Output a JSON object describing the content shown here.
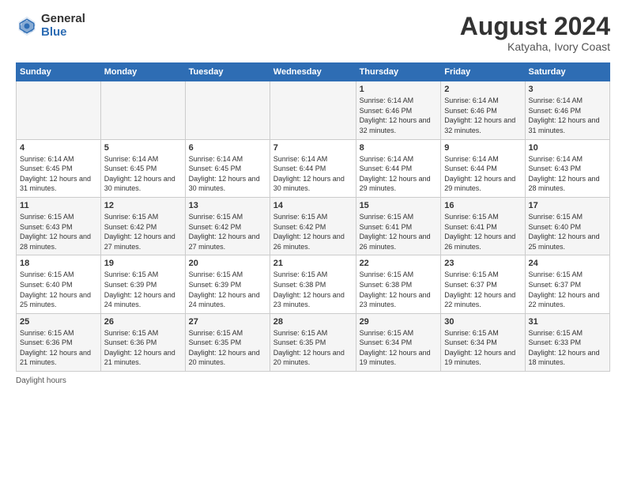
{
  "header": {
    "logo_general": "General",
    "logo_blue": "Blue",
    "month_title": "August 2024",
    "subtitle": "Katyaha, Ivory Coast"
  },
  "footer": {
    "note": "Daylight hours"
  },
  "weekdays": [
    "Sunday",
    "Monday",
    "Tuesday",
    "Wednesday",
    "Thursday",
    "Friday",
    "Saturday"
  ],
  "weeks": [
    [
      {
        "day": "",
        "info": ""
      },
      {
        "day": "",
        "info": ""
      },
      {
        "day": "",
        "info": ""
      },
      {
        "day": "",
        "info": ""
      },
      {
        "day": "1",
        "info": "Sunrise: 6:14 AM\nSunset: 6:46 PM\nDaylight: 12 hours\nand 32 minutes."
      },
      {
        "day": "2",
        "info": "Sunrise: 6:14 AM\nSunset: 6:46 PM\nDaylight: 12 hours\nand 32 minutes."
      },
      {
        "day": "3",
        "info": "Sunrise: 6:14 AM\nSunset: 6:46 PM\nDaylight: 12 hours\nand 31 minutes."
      }
    ],
    [
      {
        "day": "4",
        "info": "Sunrise: 6:14 AM\nSunset: 6:45 PM\nDaylight: 12 hours\nand 31 minutes."
      },
      {
        "day": "5",
        "info": "Sunrise: 6:14 AM\nSunset: 6:45 PM\nDaylight: 12 hours\nand 30 minutes."
      },
      {
        "day": "6",
        "info": "Sunrise: 6:14 AM\nSunset: 6:45 PM\nDaylight: 12 hours\nand 30 minutes."
      },
      {
        "day": "7",
        "info": "Sunrise: 6:14 AM\nSunset: 6:44 PM\nDaylight: 12 hours\nand 30 minutes."
      },
      {
        "day": "8",
        "info": "Sunrise: 6:14 AM\nSunset: 6:44 PM\nDaylight: 12 hours\nand 29 minutes."
      },
      {
        "day": "9",
        "info": "Sunrise: 6:14 AM\nSunset: 6:44 PM\nDaylight: 12 hours\nand 29 minutes."
      },
      {
        "day": "10",
        "info": "Sunrise: 6:14 AM\nSunset: 6:43 PM\nDaylight: 12 hours\nand 28 minutes."
      }
    ],
    [
      {
        "day": "11",
        "info": "Sunrise: 6:15 AM\nSunset: 6:43 PM\nDaylight: 12 hours\nand 28 minutes."
      },
      {
        "day": "12",
        "info": "Sunrise: 6:15 AM\nSunset: 6:42 PM\nDaylight: 12 hours\nand 27 minutes."
      },
      {
        "day": "13",
        "info": "Sunrise: 6:15 AM\nSunset: 6:42 PM\nDaylight: 12 hours\nand 27 minutes."
      },
      {
        "day": "14",
        "info": "Sunrise: 6:15 AM\nSunset: 6:42 PM\nDaylight: 12 hours\nand 26 minutes."
      },
      {
        "day": "15",
        "info": "Sunrise: 6:15 AM\nSunset: 6:41 PM\nDaylight: 12 hours\nand 26 minutes."
      },
      {
        "day": "16",
        "info": "Sunrise: 6:15 AM\nSunset: 6:41 PM\nDaylight: 12 hours\nand 26 minutes."
      },
      {
        "day": "17",
        "info": "Sunrise: 6:15 AM\nSunset: 6:40 PM\nDaylight: 12 hours\nand 25 minutes."
      }
    ],
    [
      {
        "day": "18",
        "info": "Sunrise: 6:15 AM\nSunset: 6:40 PM\nDaylight: 12 hours\nand 25 minutes."
      },
      {
        "day": "19",
        "info": "Sunrise: 6:15 AM\nSunset: 6:39 PM\nDaylight: 12 hours\nand 24 minutes."
      },
      {
        "day": "20",
        "info": "Sunrise: 6:15 AM\nSunset: 6:39 PM\nDaylight: 12 hours\nand 24 minutes."
      },
      {
        "day": "21",
        "info": "Sunrise: 6:15 AM\nSunset: 6:38 PM\nDaylight: 12 hours\nand 23 minutes."
      },
      {
        "day": "22",
        "info": "Sunrise: 6:15 AM\nSunset: 6:38 PM\nDaylight: 12 hours\nand 23 minutes."
      },
      {
        "day": "23",
        "info": "Sunrise: 6:15 AM\nSunset: 6:37 PM\nDaylight: 12 hours\nand 22 minutes."
      },
      {
        "day": "24",
        "info": "Sunrise: 6:15 AM\nSunset: 6:37 PM\nDaylight: 12 hours\nand 22 minutes."
      }
    ],
    [
      {
        "day": "25",
        "info": "Sunrise: 6:15 AM\nSunset: 6:36 PM\nDaylight: 12 hours\nand 21 minutes."
      },
      {
        "day": "26",
        "info": "Sunrise: 6:15 AM\nSunset: 6:36 PM\nDaylight: 12 hours\nand 21 minutes."
      },
      {
        "day": "27",
        "info": "Sunrise: 6:15 AM\nSunset: 6:35 PM\nDaylight: 12 hours\nand 20 minutes."
      },
      {
        "day": "28",
        "info": "Sunrise: 6:15 AM\nSunset: 6:35 PM\nDaylight: 12 hours\nand 20 minutes."
      },
      {
        "day": "29",
        "info": "Sunrise: 6:15 AM\nSunset: 6:34 PM\nDaylight: 12 hours\nand 19 minutes."
      },
      {
        "day": "30",
        "info": "Sunrise: 6:15 AM\nSunset: 6:34 PM\nDaylight: 12 hours\nand 19 minutes."
      },
      {
        "day": "31",
        "info": "Sunrise: 6:15 AM\nSunset: 6:33 PM\nDaylight: 12 hours\nand 18 minutes."
      }
    ]
  ]
}
